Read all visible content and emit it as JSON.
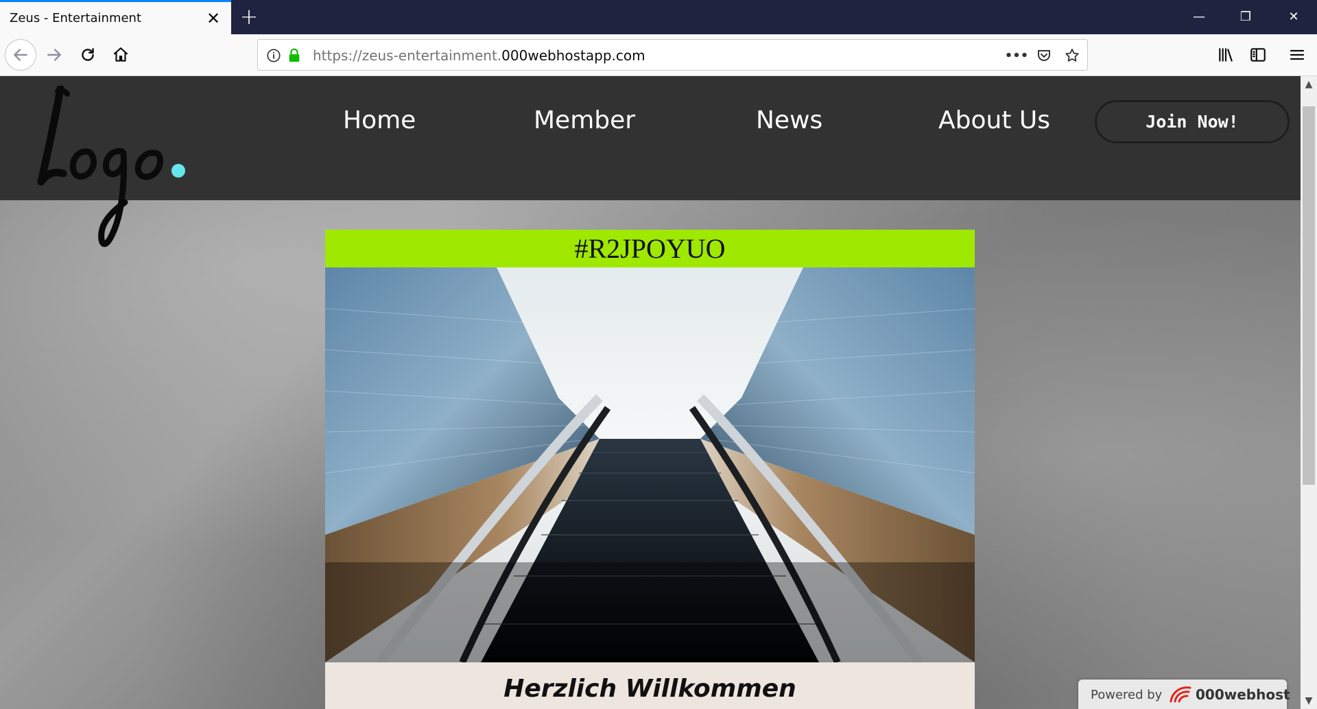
{
  "browser": {
    "tab_title": "Zeus - Entertainment",
    "tab_close": "✕",
    "new_tab": "+",
    "window_controls": {
      "minimize": "—",
      "restore": "❐",
      "close": "✕"
    },
    "url_prefix": "https://zeus-entertainment.",
    "url_host": "000webhostapp.com",
    "url_menu": "•••",
    "icons": [
      "back-icon",
      "forward-icon",
      "reload-icon",
      "home-icon",
      "info-icon",
      "lock-icon",
      "page-actions-icon",
      "pocket-icon",
      "bookmark-star-icon",
      "library-icon",
      "sidebar-icon",
      "menu-icon"
    ]
  },
  "site": {
    "nav": [
      "Home",
      "Member",
      "News",
      "About Us"
    ],
    "join_button": "Join Now!",
    "card_title": "#R2JPOYUO",
    "card_caption": "Herzlich Willkommen",
    "accent_color": "#9fe800",
    "logo_dot_color": "#66e5ee"
  },
  "footer_badge": {
    "label": "Powered by",
    "brand": "000webhost"
  }
}
